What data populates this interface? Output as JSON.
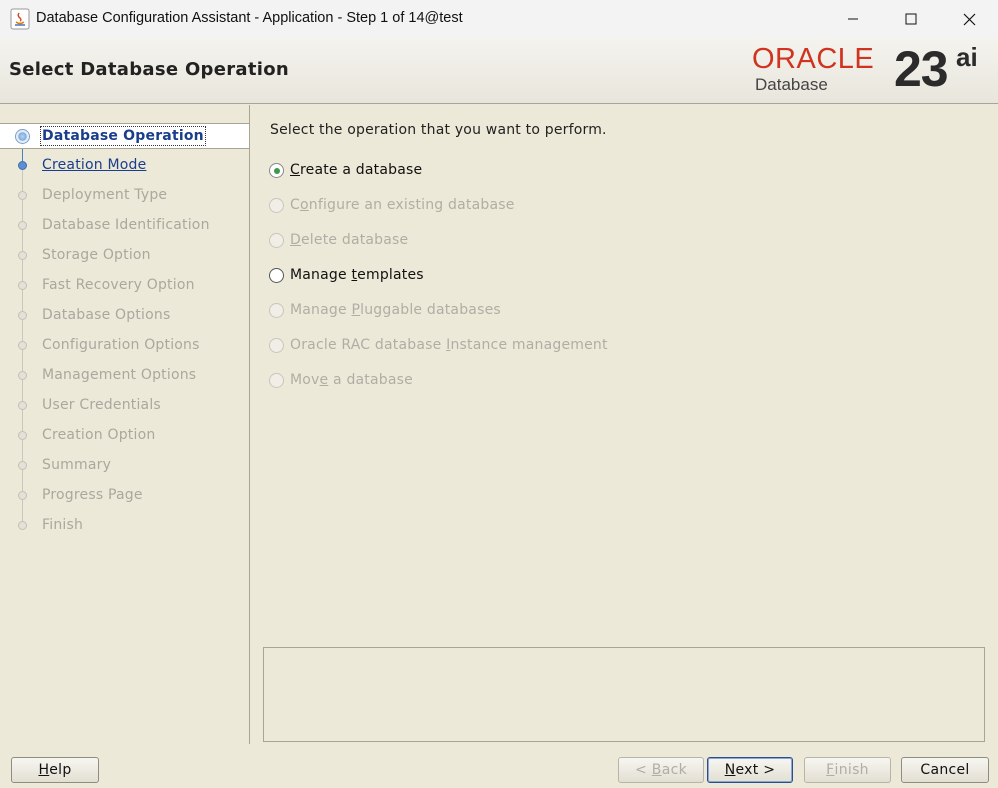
{
  "window": {
    "title": "Database Configuration Assistant - Application - Step 1 of 14@test"
  },
  "header": {
    "page_title": "Select Database Operation",
    "logo_brand": "ORACLE",
    "logo_product": "Database",
    "logo_version": "23",
    "logo_suffix": "ai"
  },
  "nav": {
    "items": [
      {
        "label": "Database Operation",
        "state": "current"
      },
      {
        "label": "Creation Mode",
        "state": "next"
      },
      {
        "label": "Deployment Type",
        "state": "disabled"
      },
      {
        "label": "Database Identification",
        "state": "disabled"
      },
      {
        "label": "Storage Option",
        "state": "disabled"
      },
      {
        "label": "Fast Recovery Option",
        "state": "disabled"
      },
      {
        "label": "Database Options",
        "state": "disabled"
      },
      {
        "label": "Configuration Options",
        "state": "disabled"
      },
      {
        "label": "Management Options",
        "state": "disabled"
      },
      {
        "label": "User Credentials",
        "state": "disabled"
      },
      {
        "label": "Creation Option",
        "state": "disabled"
      },
      {
        "label": "Summary",
        "state": "disabled"
      },
      {
        "label": "Progress Page",
        "state": "disabled"
      },
      {
        "label": "Finish",
        "state": "disabled"
      }
    ]
  },
  "content": {
    "prompt": "Select the operation that you want to perform.",
    "options": [
      {
        "pre": "",
        "mn": "C",
        "post": "reate a database",
        "checked": true,
        "enabled": true
      },
      {
        "pre": "C",
        "mn": "o",
        "post": "nfigure an existing database",
        "checked": false,
        "enabled": false
      },
      {
        "pre": "",
        "mn": "D",
        "post": "elete database",
        "checked": false,
        "enabled": false
      },
      {
        "pre": "Manage ",
        "mn": "t",
        "post": "emplates",
        "checked": false,
        "enabled": true
      },
      {
        "pre": "Manage ",
        "mn": "P",
        "post": "luggable databases",
        "checked": false,
        "enabled": false
      },
      {
        "pre": "Oracle RAC database ",
        "mn": "I",
        "post": "nstance management",
        "checked": false,
        "enabled": false
      },
      {
        "pre": "Mov",
        "mn": "e",
        "post": " a database",
        "checked": false,
        "enabled": false
      }
    ]
  },
  "buttons": {
    "help": {
      "pre": "",
      "mn": "H",
      "post": "elp"
    },
    "back": {
      "pre": "< ",
      "mn": "B",
      "post": "ack"
    },
    "next": {
      "pre": "",
      "mn": "N",
      "post": "ext >"
    },
    "finish": {
      "pre": "",
      "mn": "F",
      "post": "inish"
    },
    "cancel": {
      "pre": "Cancel",
      "mn": "",
      "post": ""
    }
  }
}
